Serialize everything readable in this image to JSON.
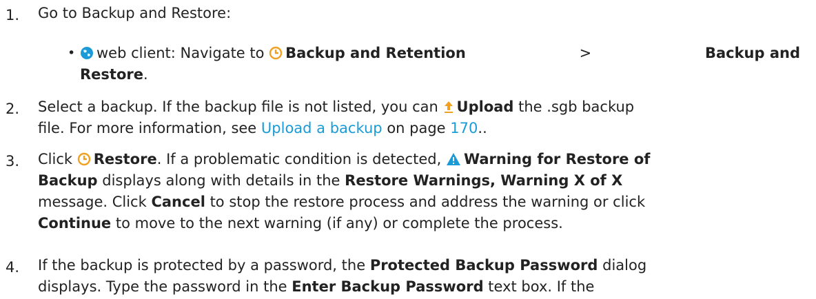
{
  "colors": {
    "text": "#222222",
    "link": "#1a9bd7",
    "icon_blue": "#1a9bd7",
    "icon_orange": "#f0a020"
  },
  "steps": [
    {
      "num": "1.",
      "text": "Go to Backup and Restore:",
      "sub": {
        "icon": "globe-icon",
        "label": "web client: Navigate to",
        "nav_icon": "clock-history-icon",
        "bold1": "Backup and Retention",
        "sep": ">",
        "bold2a": "Backup and",
        "bold2b": "Restore",
        "end": "."
      }
    },
    {
      "num": "2.",
      "a": "Select a backup. If the backup file is not listed, you can",
      "upload_icon": "upload-icon",
      "upload": "Upload",
      "b": "the .sgb backup",
      "c": "file. For more information, see",
      "link": "Upload a backup",
      "d": "on page",
      "page": "170",
      "e": ".."
    },
    {
      "num": "3.",
      "a": "Click",
      "restore_icon": "restore-icon",
      "restore": "Restore",
      "b": ". If a problematic condition is detected,",
      "warn_icon": "warning-icon",
      "warn": "Warning for Restore of",
      "warn2": "Backup",
      "c": "displays along with details in the",
      "msg": "Restore Warnings, Warning X of X",
      "d": "message. Click",
      "cancel": "Cancel",
      "e": "to stop the restore process and address the warning or click",
      "cont": "Continue",
      "f": "to move to the next warning (if any) or complete the process."
    },
    {
      "num": "4.",
      "a": "If the backup is protected by a password, the",
      "pbp": "Protected Backup Password",
      "b": "dialog",
      "c": "displays. Type the password in the",
      "ebp": "Enter Backup Password",
      "d": "text box. If the"
    }
  ]
}
